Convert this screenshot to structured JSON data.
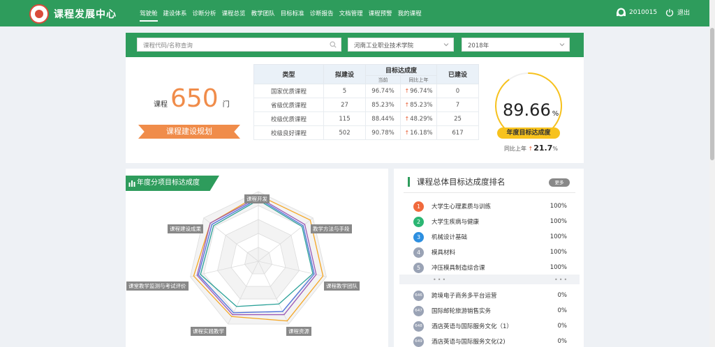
{
  "app": {
    "title": "课程发展中心",
    "nav": [
      "驾驶舱",
      "建设体系",
      "诊断分析",
      "课程总览",
      "教学团队",
      "目标标准",
      "诊断报告",
      "文档管理",
      "课程预警",
      "我的课程"
    ],
    "active_nav": 0,
    "user_id": "2010015",
    "logout_label": "退出"
  },
  "filters": {
    "search_placeholder": "课程代码/名称查询",
    "school": "河南工业职业技术学院",
    "year": "2018年"
  },
  "summary": {
    "prefix": "课程",
    "count": "650",
    "unit": "门",
    "plan_label": "课程建设规划"
  },
  "table": {
    "headers": {
      "type": "类型",
      "planned": "拟建设",
      "rate": "目标达成度",
      "current": "当前",
      "yoy": "同比上年",
      "built": "已建设"
    },
    "rows": [
      {
        "type": "国家优质课程",
        "planned": "5",
        "current": "96.74%",
        "yoy": "96.74%",
        "built": "0"
      },
      {
        "type": "省级优质课程",
        "planned": "27",
        "current": "85.23%",
        "yoy": "85.23%",
        "built": "7"
      },
      {
        "type": "校级优质课程",
        "planned": "115",
        "current": "88.44%",
        "yoy": "48.29%",
        "built": "25"
      },
      {
        "type": "校级良好课程",
        "planned": "502",
        "current": "90.78%",
        "yoy": "16.18%",
        "built": "617"
      }
    ]
  },
  "gauge": {
    "value": "89.66",
    "unit": "%",
    "fraction": 0.8966,
    "badge": "年度目标达成度",
    "yoy_label": "同比上年",
    "yoy_value": "21.7",
    "yoy_unit": "%"
  },
  "radar": {
    "title": "年度分项目标达成度",
    "axes": [
      "课程开发",
      "教学方法与手段",
      "课程教学团队",
      "课程资源",
      "课程实践教学",
      "课堂教学监测与考试评价",
      "课程建设成果"
    ],
    "series_colors": [
      "#f5a623",
      "#9b59b6",
      "#4a6fdc",
      "#2aa198"
    ],
    "series": [
      {
        "values": [
          0.95,
          0.95,
          0.95,
          0.95,
          0.88,
          0.95,
          0.88
        ]
      },
      {
        "values": [
          0.92,
          0.85,
          0.85,
          0.85,
          0.85,
          0.9,
          0.88
        ]
      },
      {
        "values": [
          0.9,
          0.82,
          0.82,
          0.8,
          0.82,
          0.88,
          0.85
        ]
      },
      {
        "values": [
          0.88,
          0.8,
          0.8,
          0.68,
          0.72,
          0.85,
          0.82
        ]
      }
    ],
    "grid_color": "#e9e9e9"
  },
  "ranking": {
    "title": "课程总体目标达成度排名",
    "more_label": "更多",
    "top": [
      {
        "rank": "1",
        "name": "大学生心理素质与训练",
        "pct": "100%",
        "color": "#f06a3d"
      },
      {
        "rank": "2",
        "name": "大学生疾病与健康",
        "pct": "100%",
        "color": "#2bb673"
      },
      {
        "rank": "3",
        "name": "机械设计基础",
        "pct": "100%",
        "color": "#2d8fe0"
      },
      {
        "rank": "4",
        "name": "模具材料",
        "pct": "100%",
        "color": "#9aa3b5"
      },
      {
        "rank": "5",
        "name": "冲压模具制造综合课",
        "pct": "100%",
        "color": "#9aa3b5"
      }
    ],
    "separator": "•••",
    "bottom": [
      {
        "rank": "646",
        "name": "跨境电子商务多平台运营",
        "pct": "0%",
        "color": "#9aa3b5"
      },
      {
        "rank": "647",
        "name": "国际邮轮旅游销售实务",
        "pct": "0%",
        "color": "#9aa3b5"
      },
      {
        "rank": "648",
        "name": "酒店英语与国际服务文化（1）",
        "pct": "0%",
        "color": "#9aa3b5"
      },
      {
        "rank": "649",
        "name": "酒店英语与国际服务文化(2)",
        "pct": "0%",
        "color": "#9aa3b5"
      }
    ]
  }
}
